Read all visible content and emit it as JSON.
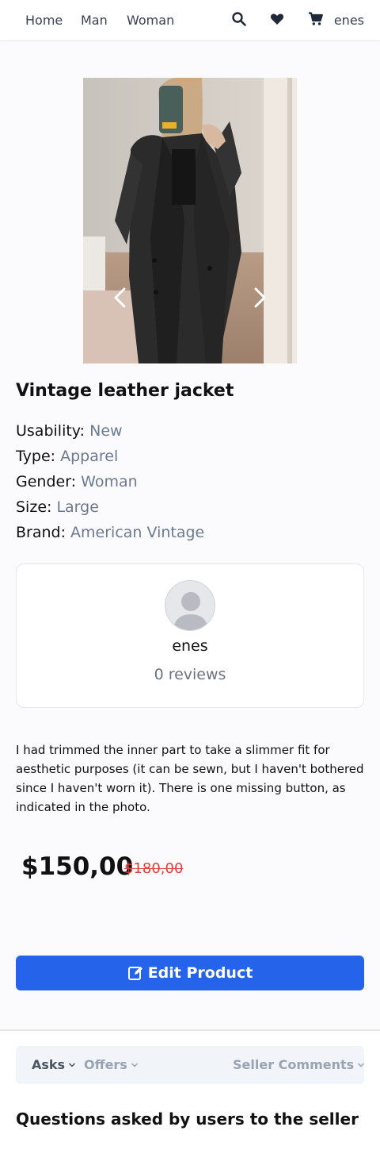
{
  "nav": {
    "links": [
      "Home",
      "Man",
      "Woman"
    ],
    "icons": [
      "search-icon",
      "heart-icon",
      "cart-icon"
    ],
    "username": "enes"
  },
  "carousel": {
    "slide_count": 4,
    "active_slide": 1
  },
  "product": {
    "title": "Vintage leather jacket",
    "specs": [
      {
        "label": "Usability:",
        "value": "New"
      },
      {
        "label": "Type:",
        "value": "Apparel"
      },
      {
        "label": "Gender:",
        "value": "Woman"
      },
      {
        "label": "Size:",
        "value": "Large"
      },
      {
        "label": "Brand:",
        "value": "American Vintage"
      }
    ],
    "description": "I had trimmed the inner part to take a slimmer fit for aesthetic purposes (it can be sewn, but I haven't bothered since I haven't worn it). There is one missing button, as indicated in the photo.",
    "price": "$150,00",
    "old_price": "$180,00"
  },
  "seller": {
    "name": "enes",
    "reviews": "0 reviews"
  },
  "actions": {
    "edit_label": "Edit Product"
  },
  "tabs": [
    {
      "label": "Asks"
    },
    {
      "label": "Offers"
    },
    {
      "label": "Seller Comments"
    }
  ],
  "questions": {
    "title": "Questions asked by users to the seller"
  },
  "colors": {
    "primary": "#2563eb",
    "old_price": "#e53e3e",
    "muted": "#6b7a90"
  }
}
